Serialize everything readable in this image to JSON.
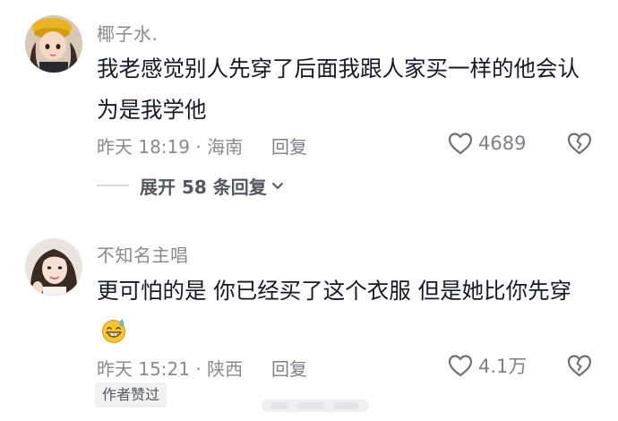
{
  "comments": [
    {
      "username": "椰子水.",
      "content": "我老感觉别人先穿了后面我跟人家买一样的他会认为是我学他",
      "meta": "昨天 18:19 · 海南",
      "reply_label": "回复",
      "like_count": "4689",
      "expand_label": "展开 58 条回复"
    },
    {
      "username": "不知名主唱",
      "content": "更可怕的是 你已经买了这个衣服 但是她比你先穿",
      "meta": "昨天 15:21 · 陕西",
      "reply_label": "回复",
      "like_count": "4.1万",
      "badge": "作者赞过"
    }
  ],
  "icons": {
    "like": "heart-outline-icon",
    "dislike": "broken-heart-icon",
    "expand": "chevron-down-icon",
    "emoji": "grinning-sweat-emoji"
  },
  "colors": {
    "text_primary": "#161823",
    "text_secondary": "#8a8b91",
    "badge_bg": "#f1f1f2"
  }
}
